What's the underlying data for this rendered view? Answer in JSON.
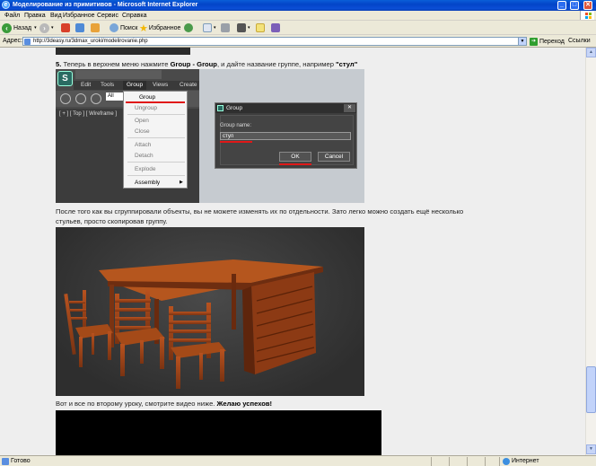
{
  "window": {
    "title": "Моделирование из примитивов - Microsoft Internet Explorer"
  },
  "menu": [
    "Файл",
    "Правка",
    "Вид",
    "Избранное",
    "Сервис",
    "Справка"
  ],
  "toolbar": {
    "back_label": "Назад",
    "search_label": "Поиск",
    "favorites_label": "Избранное"
  },
  "address": {
    "label": "Адрес:",
    "url": "http://3deasy.ru/3dmax_uroki/modelirovanie.php",
    "go_label": "Переход",
    "links_label": "Ссылки"
  },
  "article": {
    "step_number": "5.",
    "step_text_before": " Теперь в верхнем меню нажмите ",
    "step_menu_path": "Group - Group",
    "step_text_after": ", и дайте название группе, например ",
    "step_example": "\"стул\"",
    "para_grouped_line1": "После того как вы сгруппировали объекты, вы не можете изменять их по отдельности. Зато легко можно создать ещё несколько",
    "para_grouped_line2": "стульев, просто скопировав группу.",
    "para_end_before": "Вот и все по второму уроку, смотрите видео ниже. ",
    "para_end_bold": "Желаю успехов!"
  },
  "max_ui": {
    "menu": [
      "Edit",
      "Tools",
      "Group",
      "Views",
      "Create"
    ],
    "filter_value": "All",
    "viewport_label": "[ + ] [ Top ] [ Wireframe ]",
    "group_menu_items": [
      "Group",
      "Ungroup",
      "Open",
      "Close",
      "Attach",
      "Detach",
      "Explode",
      "Assembly"
    ],
    "dialog": {
      "title": "Group",
      "close_glyph": "✕",
      "field_label": "Group name:",
      "field_value": "стул",
      "ok_label": "OK",
      "cancel_label": "Cancel"
    }
  },
  "status": {
    "text": "Готово",
    "zone": "Интернет"
  },
  "colors": {
    "accent_red": "#e01818",
    "furniture": "#a0451a",
    "titlebar": "#0a5fd8"
  }
}
